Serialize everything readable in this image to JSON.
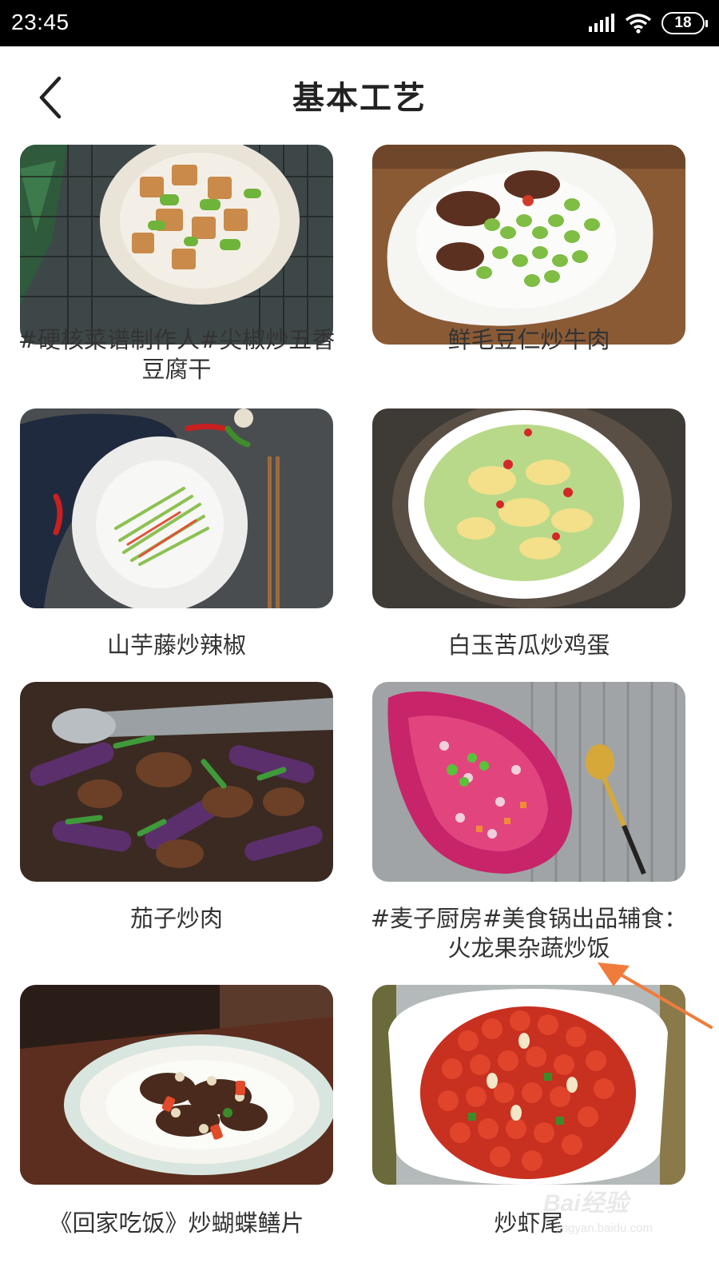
{
  "status": {
    "time": "23:45",
    "battery": "18"
  },
  "header": {
    "title": "基本工艺"
  },
  "recipes": [
    {
      "title": "#硬核菜谱制作人#尖椒炒五香豆腐干"
    },
    {
      "title": "鲜毛豆仁炒牛肉"
    },
    {
      "title": "山芋藤炒辣椒"
    },
    {
      "title": "白玉苦瓜炒鸡蛋"
    },
    {
      "title": "茄子炒肉"
    },
    {
      "title": "#麦子厨房#美食锅出品辅食：火龙果杂蔬炒饭"
    },
    {
      "title": "《回家吃饭》炒蝴蝶鳝片"
    },
    {
      "title": "炒虾尾"
    }
  ],
  "watermark": {
    "logo": "Bai经验",
    "url": "jingyan.baidu.com"
  },
  "colors": {
    "arrow": "#f07c3c",
    "title": "#222222",
    "text": "#333333"
  }
}
